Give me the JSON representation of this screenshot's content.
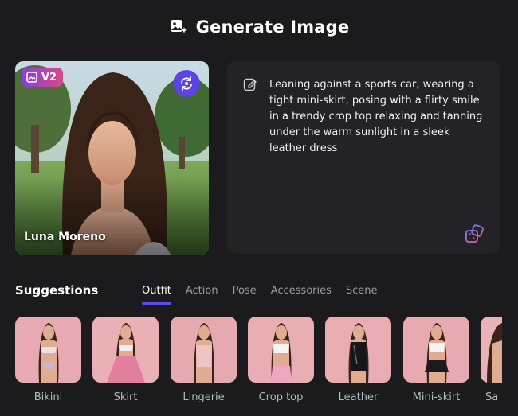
{
  "header": {
    "title": "Generate Image",
    "icon": "image-sparkle-icon"
  },
  "character": {
    "name": "Luna Moreno",
    "version_badge": "V2",
    "swap_icon": "swap-refresh-icon"
  },
  "prompt": {
    "text": "Leaning against a sports car, wearing a tight mini-skirt, posing with a flirty smile in a trendy crop top relaxing and tanning under the warm sunlight in a sleek leather dress",
    "edit_icon": "edit-icon",
    "dice_icon": "dice-icon"
  },
  "suggestions": {
    "title": "Suggestions",
    "tabs": [
      "Outfit",
      "Action",
      "Pose",
      "Accessories",
      "Scene"
    ],
    "active_tab": "Outfit",
    "items": [
      {
        "label": "Bikini"
      },
      {
        "label": "Skirt"
      },
      {
        "label": "Lingerie"
      },
      {
        "label": "Crop top"
      },
      {
        "label": "Leather"
      },
      {
        "label": "Mini-skirt"
      },
      {
        "label": "Sa"
      }
    ]
  },
  "colors": {
    "accent": "#5b43e6",
    "badge_gradient_start": "#8b3fd8",
    "badge_gradient_end": "#d64b86",
    "background": "#1b1b1d"
  }
}
